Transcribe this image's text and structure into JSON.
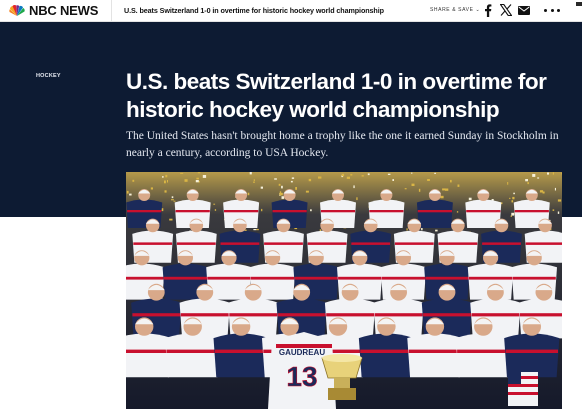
{
  "nav": {
    "brand": "NBC NEWS",
    "headline": "U.S. beats Switzerland 1-0 in overtime for historic hockey world championship",
    "share_label": "SHARE & SAVE",
    "icons": [
      "peacock-logo-icon",
      "chevron-down-icon",
      "facebook-icon",
      "x-icon",
      "email-icon",
      "more-icon"
    ]
  },
  "article": {
    "section": "HOCKEY",
    "headline": "U.S. beats Switzerland 1-0 in overtime for historic hockey world championship",
    "dek": "The United States hasn't brought home a trophy like the one it earned Sunday in Stockholm in nearly a century, according to USA Hockey."
  },
  "photo": {
    "jersey_name": "GAUDREAU",
    "jersey_number": "13"
  },
  "colors": {
    "hero_background": "#0d1b33",
    "jersey_white": "#f2f3f6",
    "jersey_navy": "#1b2a5a",
    "jersey_red": "#c8102e",
    "confetti_gold": "#d9b545"
  }
}
